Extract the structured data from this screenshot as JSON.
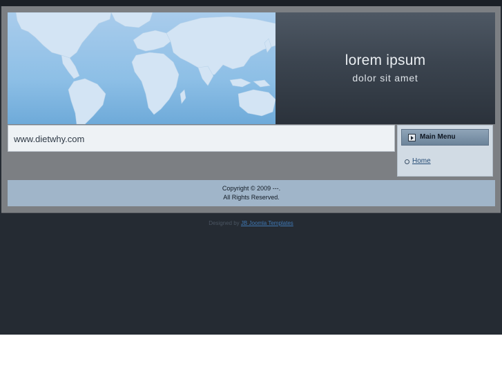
{
  "header": {
    "title": "lorem ipsum",
    "subtitle": "dolor sit amet"
  },
  "content": {
    "url_text": "www.dietwhy.com"
  },
  "main_menu": {
    "title": "Main Menu",
    "icon": "arrow-right-icon",
    "items": [
      {
        "label": "Home"
      }
    ]
  },
  "footer": {
    "copyright_line1": "Copyright © 2009 ---.",
    "copyright_line2": "All Rights Reserved."
  },
  "credit": {
    "prefix": "Designed by",
    "link_text": "JB Joomla Templates"
  },
  "colors": {
    "page_background": "#252b33",
    "frame": "#7c7f83",
    "header_panel": "#3b444f",
    "footer_bar": "#a0b5c9",
    "menu_background": "#d1dbe4",
    "link": "#244b75"
  }
}
